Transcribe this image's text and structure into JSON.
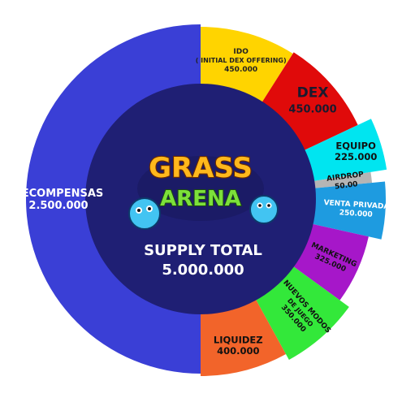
{
  "chart_data": {
    "type": "pie",
    "title": "",
    "center_label": "SUPPLY TOTAL",
    "center_value": "5.000.000",
    "logo": {
      "line1": "GRASS",
      "line2": "ARENA"
    },
    "slices": [
      {
        "key": "ido",
        "label": "IDO",
        "label_sub": "( INITIAL DEX OFFERING)",
        "value_text": "450.000",
        "value": 450000,
        "color": "#FFD400",
        "text_color": "#222222"
      },
      {
        "key": "dex",
        "label": "DEX",
        "value_text": "450.000",
        "value": 450000,
        "color": "#E00A0A",
        "text_color": "#1a1a2e"
      },
      {
        "key": "equipo",
        "label": "EQUIPO",
        "value_text": "225.000",
        "value": 225000,
        "color": "#00E5F0",
        "text_color": "#111111"
      },
      {
        "key": "airdrop",
        "label": "AIRDROP",
        "value_text": "50.00",
        "value": 50000,
        "color": "#B5B5B5",
        "text_color": "#111111"
      },
      {
        "key": "venta_privada",
        "label": "VENTA PRIVADA",
        "value_text": "250.000",
        "value": 250000,
        "color": "#1E9BE0",
        "text_color": "#ffffff"
      },
      {
        "key": "marketing",
        "label": "MARKETING",
        "value_text": "325.000",
        "value": 325000,
        "color": "#A617C9",
        "text_color": "#111111"
      },
      {
        "key": "nuevos_modos",
        "label": "NUEVOS MODOS DE JUEGO",
        "label_lines": [
          "NUEVOS MODOS",
          "DE JUEGO"
        ],
        "value_text": "350.000",
        "value": 350000,
        "color": "#33E83A",
        "text_color": "#111111"
      },
      {
        "key": "liquidez",
        "label": "LIQUIDEZ",
        "value_text": "400.000",
        "value": 400000,
        "color": "#F2642A",
        "text_color": "#111111"
      },
      {
        "key": "recompensas",
        "label": "RECOMPENSAS",
        "value_text": "2.500.000",
        "value": 2500000,
        "color": "#3A3FD6",
        "text_color": "#ffffff"
      }
    ],
    "colors": {
      "inner_disc": "#1F1F74",
      "inner_ring": "#26288C"
    }
  }
}
